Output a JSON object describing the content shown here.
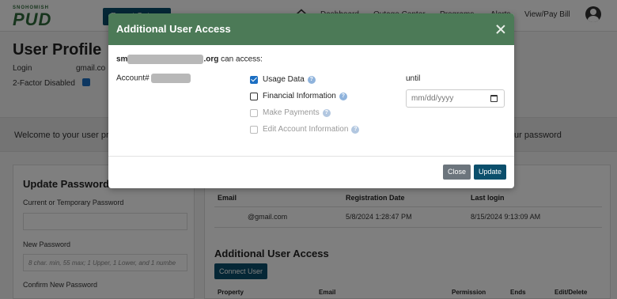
{
  "header": {
    "logo_small": "SNOHOMISH",
    "logo_big": "PUD",
    "outage_button": "Report Outage",
    "nav": [
      "Dashboard",
      "Outage Center",
      "Programs",
      "Alerts",
      "View/Pay Bill"
    ]
  },
  "profile": {
    "title": "User Profile",
    "login_label": "Login",
    "login_value": "gmail.co",
    "two_factor": "2-Factor Disabled",
    "welcome": "Welcome to your user pro",
    "welcome_right": "ur password"
  },
  "update_password": {
    "title": "Update Password",
    "current_label": "Current or Temporary Password",
    "new_label": "New Password",
    "new_placeholder": "8 char. min, 55 max; 1 Upper, 1 Lower, and 1 numbe",
    "confirm_label": "Confirm New Password"
  },
  "users_table": {
    "headers": [
      "Email",
      "Registration Date",
      "Last login"
    ],
    "row": [
      "@gmail.com",
      "5/8/2024 1:28:47 PM",
      "8/15/2024 9:13:09 AM"
    ]
  },
  "additional_access": {
    "title": "Additional User Access",
    "connect_button": "Connect User",
    "headers": [
      "Property",
      "Email",
      "Permission",
      "Ends",
      "Edit/Delete"
    ]
  },
  "modal": {
    "title": "Additional User Access",
    "email_prefix": "sm",
    "email_suffix": ".org",
    "can_access": "can access:",
    "account_label": "Account#",
    "permissions": [
      {
        "label": "Usage Data",
        "checked": true,
        "disabled": false
      },
      {
        "label": "Financial Information",
        "checked": false,
        "disabled": false
      },
      {
        "label": "Make Payments",
        "checked": false,
        "disabled": true
      },
      {
        "label": "Edit Account Information",
        "checked": false,
        "disabled": true
      }
    ],
    "help_glyph": "?",
    "until_label": "until",
    "date_placeholder": "mm/dd/yyyy",
    "close_button": "Close",
    "update_button": "Update"
  }
}
